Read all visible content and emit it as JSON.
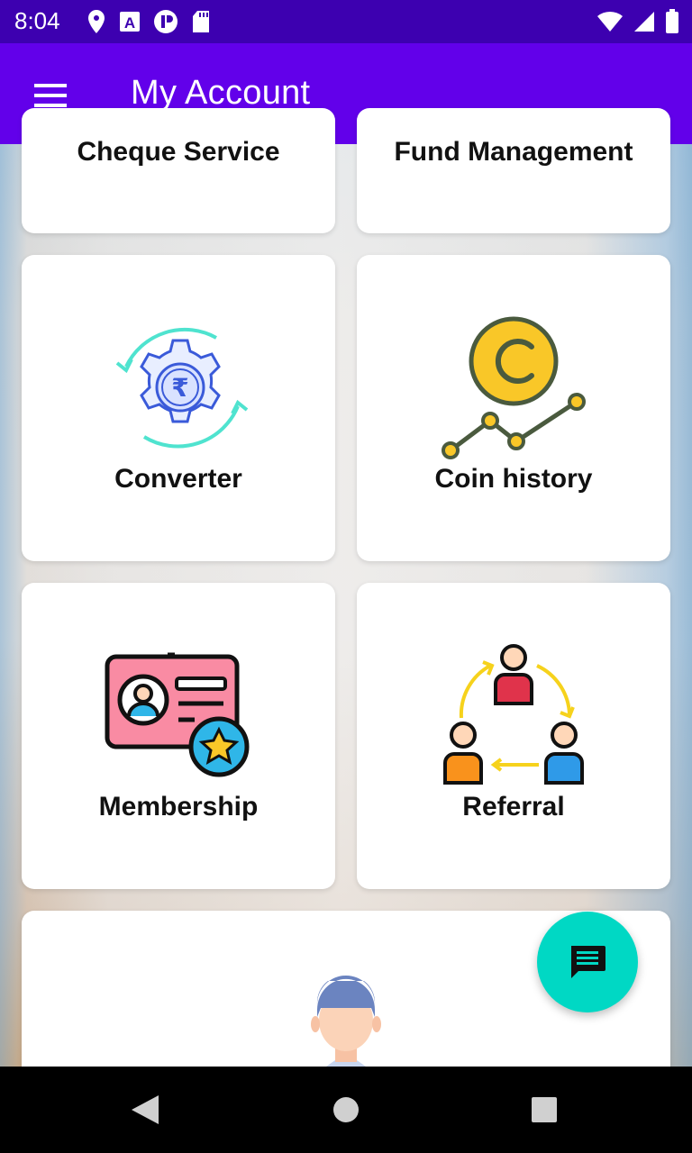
{
  "status_bar": {
    "time": "8:04",
    "icons_left": [
      "location-icon",
      "a-text-icon",
      "vpn-icon",
      "sd-card-icon"
    ],
    "icons_right": [
      "wifi-icon",
      "signal-icon",
      "battery-icon"
    ]
  },
  "app_bar": {
    "title": "My Account",
    "menu_icon": "hamburger-menu-icon"
  },
  "cards": [
    {
      "id": "cheque",
      "label": "Cheque Service"
    },
    {
      "id": "fund",
      "label": "Fund Management"
    },
    {
      "id": "converter",
      "label": "Converter",
      "icon": "currency-converter-icon"
    },
    {
      "id": "coin",
      "label": "Coin history",
      "icon": "coin-history-icon"
    },
    {
      "id": "membership",
      "label": "Membership",
      "icon": "membership-card-icon"
    },
    {
      "id": "referral",
      "label": "Referral",
      "icon": "referral-icon"
    }
  ],
  "fab": {
    "icon": "chat-icon",
    "color": "#00d8c4"
  },
  "colors": {
    "status_bar": "#3d00b0",
    "app_bar": "#6200ea"
  },
  "nav_bar": {
    "icons": [
      "back-icon",
      "home-icon",
      "recents-icon"
    ]
  }
}
